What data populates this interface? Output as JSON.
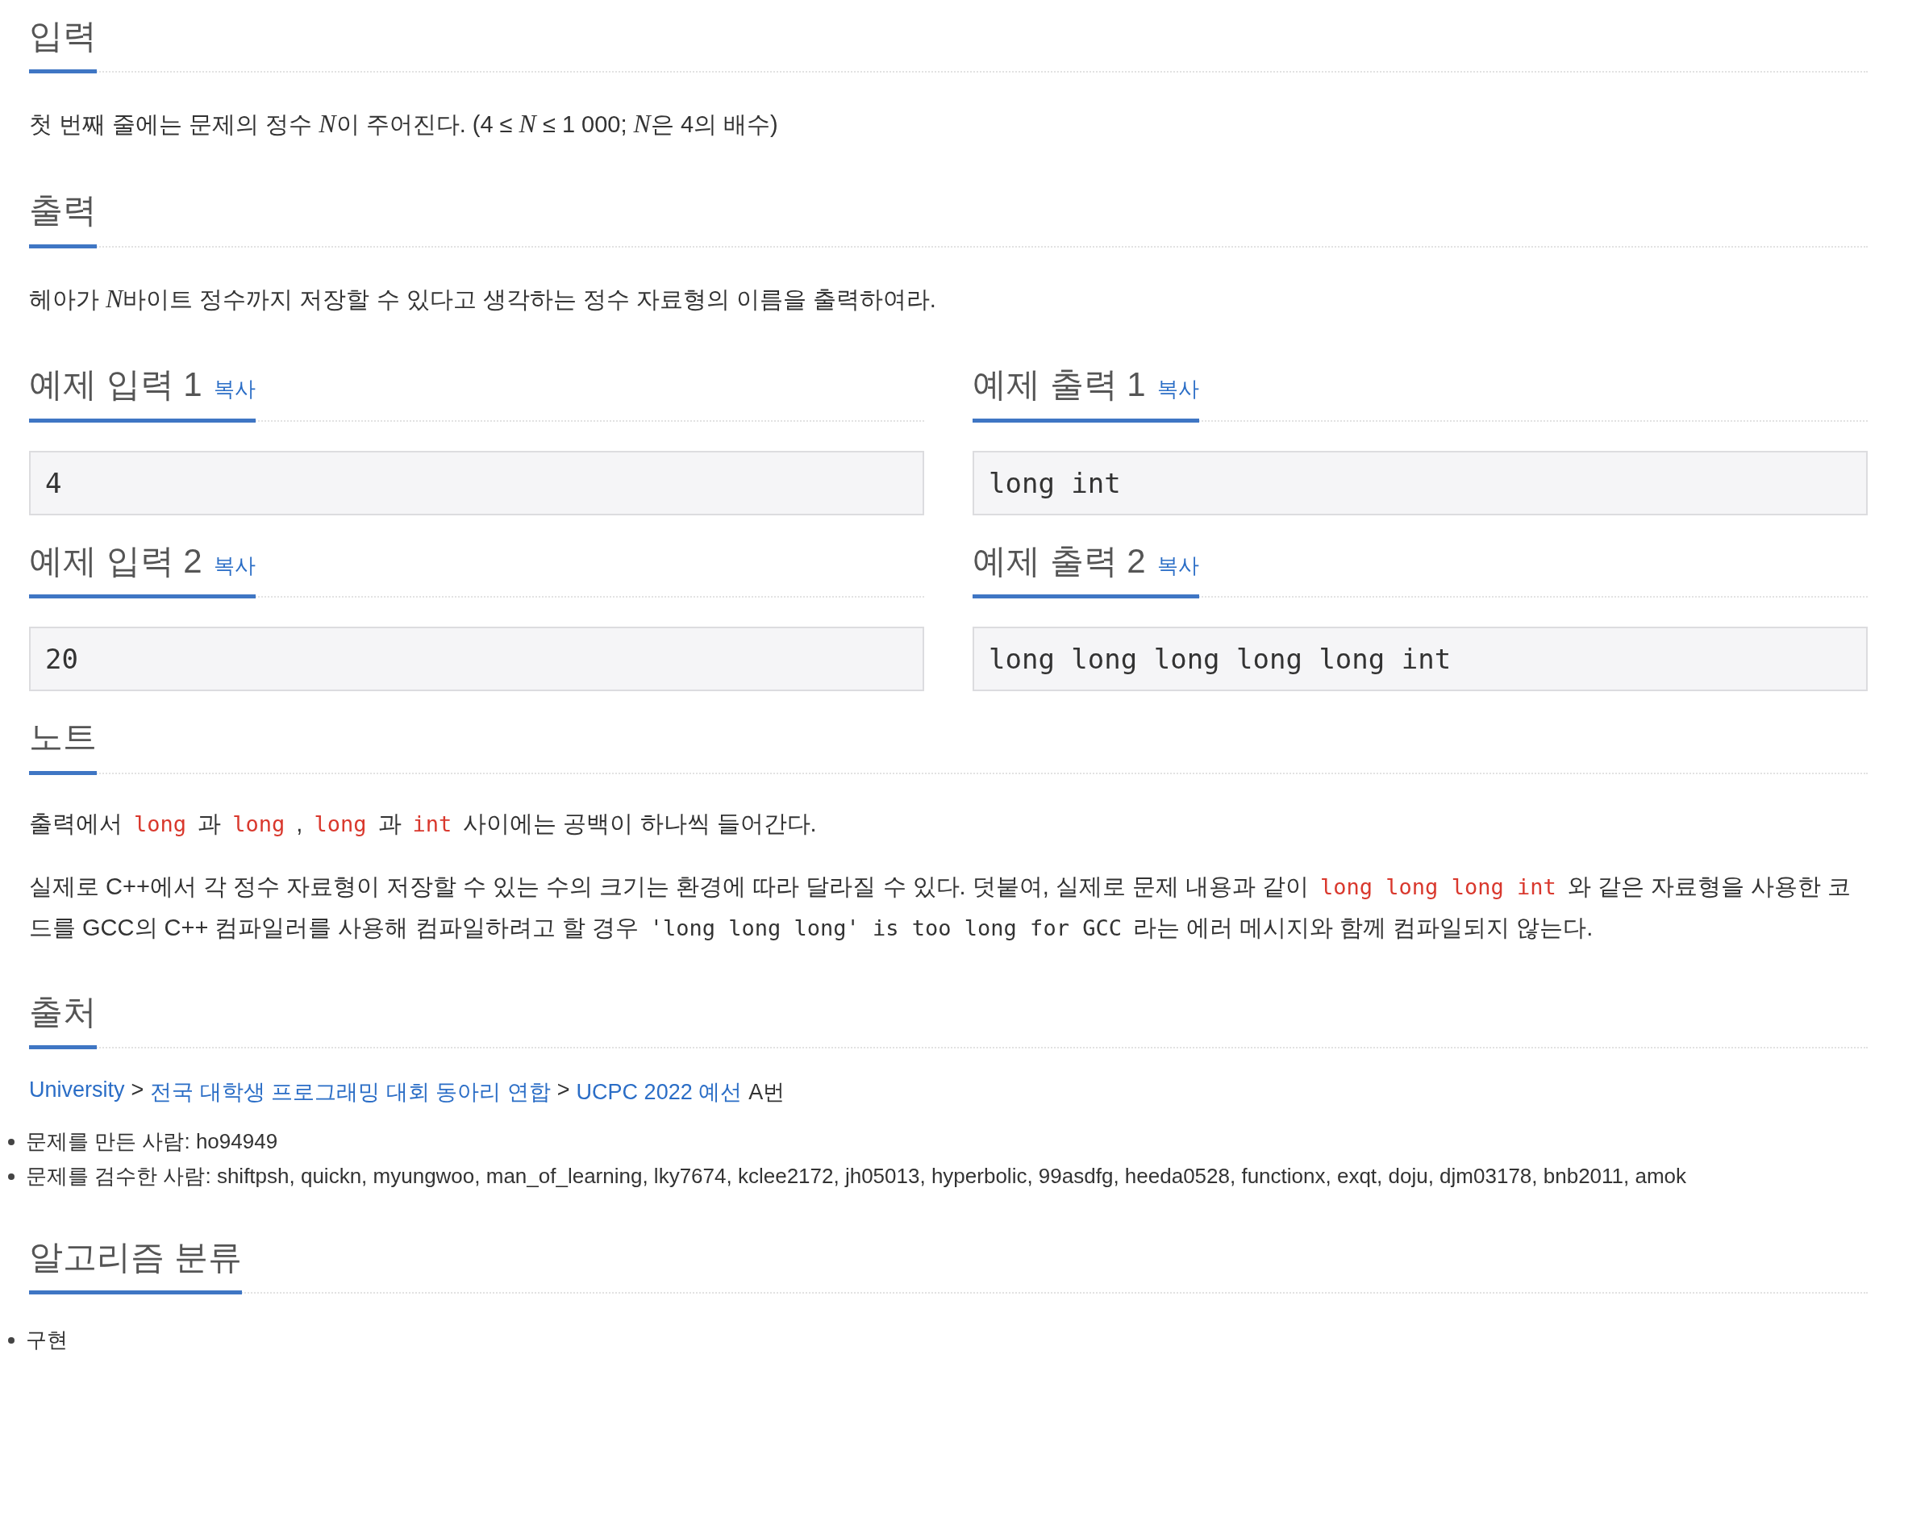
{
  "sections": [
    {
      "kind": "text",
      "title": "입력",
      "paragraphs": [
        {
          "segments": [
            {
              "kind": "text",
              "text": "첫 번째 줄에는 문제의 정수 "
            },
            {
              "kind": "math",
              "text": "N"
            },
            {
              "kind": "text",
              "text": "이 주어진다. (4 ≤ "
            },
            {
              "kind": "math",
              "text": "N"
            },
            {
              "kind": "text",
              "text": " ≤ 1 000; "
            },
            {
              "kind": "math",
              "text": "N"
            },
            {
              "kind": "text",
              "text": "은 4의 배수)"
            }
          ]
        }
      ]
    },
    {
      "kind": "text",
      "title": "출력",
      "paragraphs": [
        {
          "segments": [
            {
              "kind": "text",
              "text": "헤아가 "
            },
            {
              "kind": "math",
              "text": "N"
            },
            {
              "kind": "text",
              "text": "바이트 정수까지 저장할 수 있다고 생각하는 정수 자료형의 이름을 출력하여라."
            }
          ]
        }
      ]
    },
    {
      "kind": "samples",
      "samples": [
        {
          "title": "예제 입력 1",
          "copy": "복사",
          "value": "4"
        },
        {
          "title": "예제 출력 1",
          "copy": "복사",
          "value": "long int"
        },
        {
          "title": "예제 입력 2",
          "copy": "복사",
          "value": "20"
        },
        {
          "title": "예제 출력 2",
          "copy": "복사",
          "value": "long long long long long int"
        }
      ]
    },
    {
      "kind": "text",
      "title": "노트",
      "paragraphs": [
        {
          "segments": [
            {
              "kind": "text",
              "text": "출력에서 "
            },
            {
              "kind": "code",
              "text": "long"
            },
            {
              "kind": "text",
              "text": " 과 "
            },
            {
              "kind": "code",
              "text": "long"
            },
            {
              "kind": "text",
              "text": " , "
            },
            {
              "kind": "code",
              "text": "long"
            },
            {
              "kind": "text",
              "text": " 과 "
            },
            {
              "kind": "code",
              "text": "int"
            },
            {
              "kind": "text",
              "text": " 사이에는 공백이 하나씩 들어간다."
            }
          ]
        },
        {
          "segments": [
            {
              "kind": "text",
              "text": "실제로 C++에서 각 정수 자료형이 저장할 수 있는 수의 크기는 환경에 따라 달라질 수 있다. 덧붙여, 실제로 문제 내용과 같이 "
            },
            {
              "kind": "code",
              "text": "long long long int"
            },
            {
              "kind": "text",
              "text": " 와 같은 자료형을 사용한 코드를 GCC의 C++ 컴파일러를 사용해 컴파일하려고 할 경우 "
            },
            {
              "kind": "mono",
              "text": "'long long long' is too long for GCC"
            },
            {
              "kind": "text",
              "text": " 라는 에러 메시지와 함께 컴파일되지 않는다."
            }
          ]
        }
      ]
    },
    {
      "kind": "source",
      "title": "출처",
      "crumbs": [
        {
          "kind": "link",
          "text": "University"
        },
        {
          "kind": "sep",
          "text": ">"
        },
        {
          "kind": "link",
          "text": "전국 대학생 프로그래밍 대회 동아리 연합"
        },
        {
          "kind": "sep",
          "text": ">"
        },
        {
          "kind": "link",
          "text": "UCPC 2022 예선"
        },
        {
          "kind": "plain",
          "text": "A번"
        }
      ],
      "items": [
        "문제를 만든 사람: ho94949",
        "문제를 검수한 사람: shiftpsh, quickn, myungwoo, man_of_learning, lky7674, kclee2172, jh05013, hyperbolic, 99asdfg, heeda0528, functionx, exqt, doju, djm03178, bnb2011, amok"
      ]
    },
    {
      "kind": "tags",
      "title": "알고리즘 분류",
      "items": [
        "구현"
      ]
    }
  ]
}
